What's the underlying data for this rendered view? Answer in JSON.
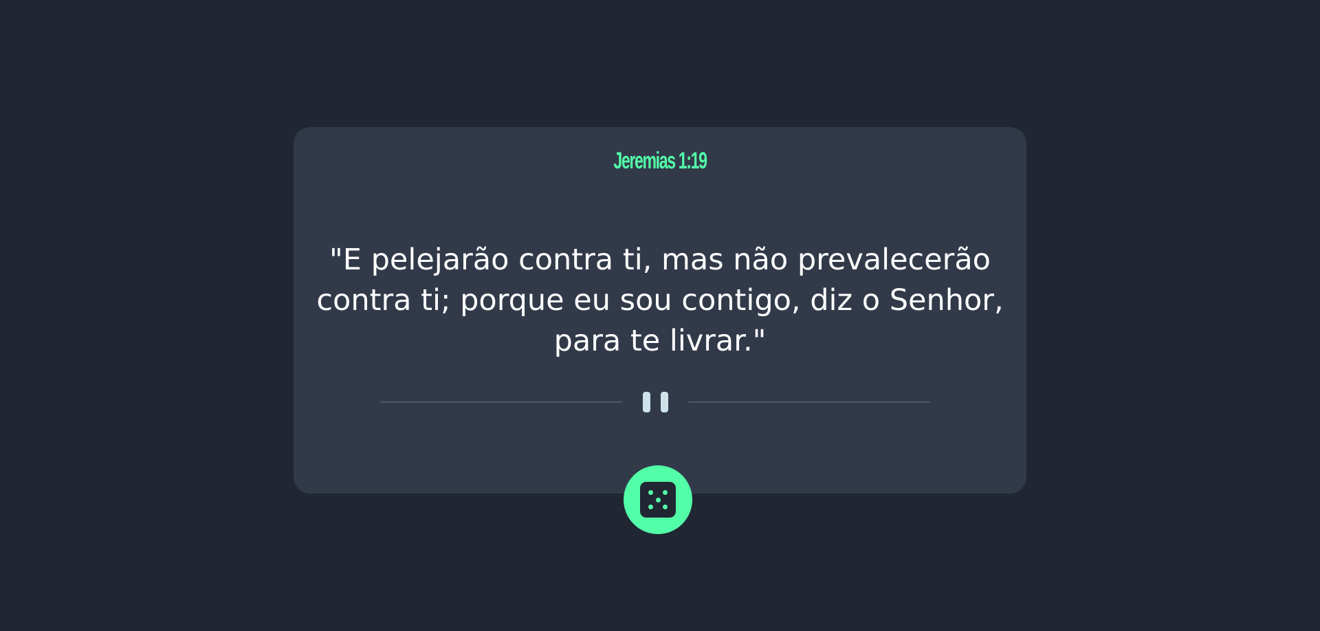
{
  "verse": {
    "reference": "Jeremias 1:19",
    "text": "\"E pelejarão contra ti, mas não prevalecerão contra ti; porque eu sou contigo, diz o Senhor, para te livrar.\""
  },
  "controls": {
    "pause_icon": "pause-icon",
    "dice_icon": "dice-icon",
    "dice_face": 5
  },
  "colors": {
    "background": "#202632",
    "card": "#323a4a",
    "accent": "#52ffa8",
    "text": "#ffffff",
    "divider": "#4e5769",
    "pause": "#cee3e9"
  }
}
